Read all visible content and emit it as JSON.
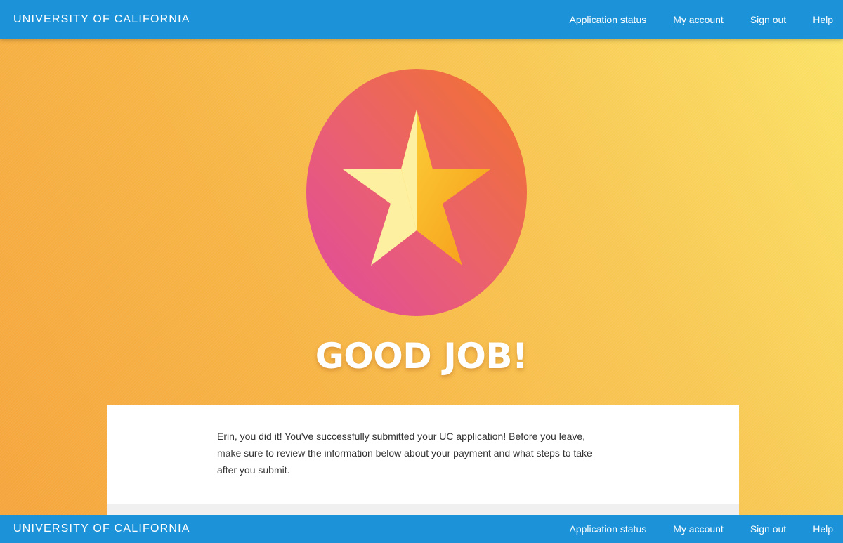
{
  "header": {
    "brand": "UNIVERSITY OF CALIFORNIA",
    "nav": [
      {
        "label": "Application status"
      },
      {
        "label": "My account"
      },
      {
        "label": "Sign out"
      },
      {
        "label": "Help"
      }
    ]
  },
  "hero": {
    "icon": "star-badge-icon",
    "headline": "GOOD JOB!"
  },
  "card": {
    "message": "Erin, you did it! You've successfully submitted your UC application! Before you leave, make sure to review the information below about your payment and what steps to take after you submit."
  },
  "footer": {
    "brand": "UNIVERSITY OF CALIFORNIA",
    "nav": [
      {
        "label": "Application status"
      },
      {
        "label": "My account"
      },
      {
        "label": "Sign out"
      },
      {
        "label": "Help"
      }
    ]
  },
  "colors": {
    "header_bg": "#1c93d9",
    "background_start": "#f5a53d",
    "background_end": "#fbe468",
    "badge_pink": "#e2559a",
    "badge_orange": "#f07030",
    "star_light": "#fdf1a0",
    "star_dark": "#f8a818"
  }
}
